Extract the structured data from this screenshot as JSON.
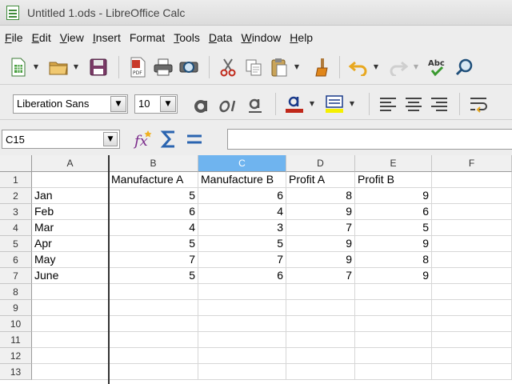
{
  "window": {
    "title": "Untitled 1.ods - LibreOffice Calc"
  },
  "menu": [
    {
      "u": "F",
      "rest": "ile"
    },
    {
      "u": "E",
      "rest": "dit"
    },
    {
      "u": "V",
      "rest": "iew"
    },
    {
      "u": "I",
      "rest": "nsert"
    },
    {
      "u": "",
      "rest": "Format"
    },
    {
      "u": "T",
      "rest": "ools"
    },
    {
      "u": "D",
      "rest": "ata"
    },
    {
      "u": "W",
      "rest": "indow"
    },
    {
      "u": "H",
      "rest": "elp"
    }
  ],
  "format_toolbar": {
    "font_name": "Liberation Sans",
    "font_size": "10"
  },
  "formula_bar": {
    "name_box": "C15",
    "input_value": ""
  },
  "colors": {
    "selected_column": "#6fb4ef",
    "font_color_swatch": "#c0281a",
    "highlight_swatch": "#f5f000"
  },
  "sheet": {
    "columns": [
      "A",
      "B",
      "C",
      "D",
      "E",
      "F"
    ],
    "selected_column": "C",
    "rows": [
      "1",
      "2",
      "3",
      "4",
      "5",
      "6",
      "7",
      "8",
      "9",
      "10",
      "11",
      "12",
      "13"
    ],
    "data": [
      [
        "",
        "Manufacture A",
        "Manufacture B",
        "Profit A",
        "Profit B",
        ""
      ],
      [
        "Jan",
        "5",
        "6",
        "8",
        "9",
        ""
      ],
      [
        "Feb",
        "6",
        "4",
        "9",
        "6",
        ""
      ],
      [
        "Mar",
        "4",
        "3",
        "7",
        "5",
        ""
      ],
      [
        "Apr",
        "5",
        "5",
        "9",
        "9",
        ""
      ],
      [
        "May",
        "7",
        "7",
        "9",
        "8",
        ""
      ],
      [
        "June",
        "5",
        "6",
        "7",
        "9",
        ""
      ]
    ]
  }
}
